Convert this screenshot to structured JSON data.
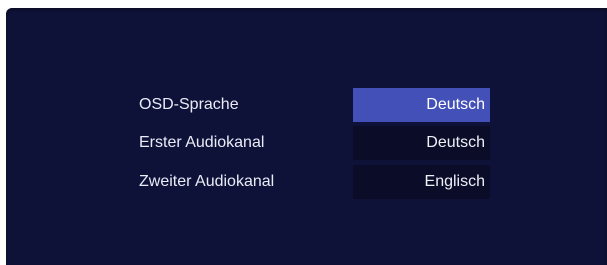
{
  "colors": {
    "background": "#0f1238",
    "value_box": "#0a0c28",
    "highlight": "#4350b8",
    "text": "#e9ecf6"
  },
  "settings": [
    {
      "label": "OSD-Sprache",
      "value": "Deutsch",
      "selected": true
    },
    {
      "label": "Erster Audiokanal",
      "value": "Deutsch",
      "selected": false
    },
    {
      "label": "Zweiter Audiokanal",
      "value": "Englisch",
      "selected": false
    }
  ]
}
